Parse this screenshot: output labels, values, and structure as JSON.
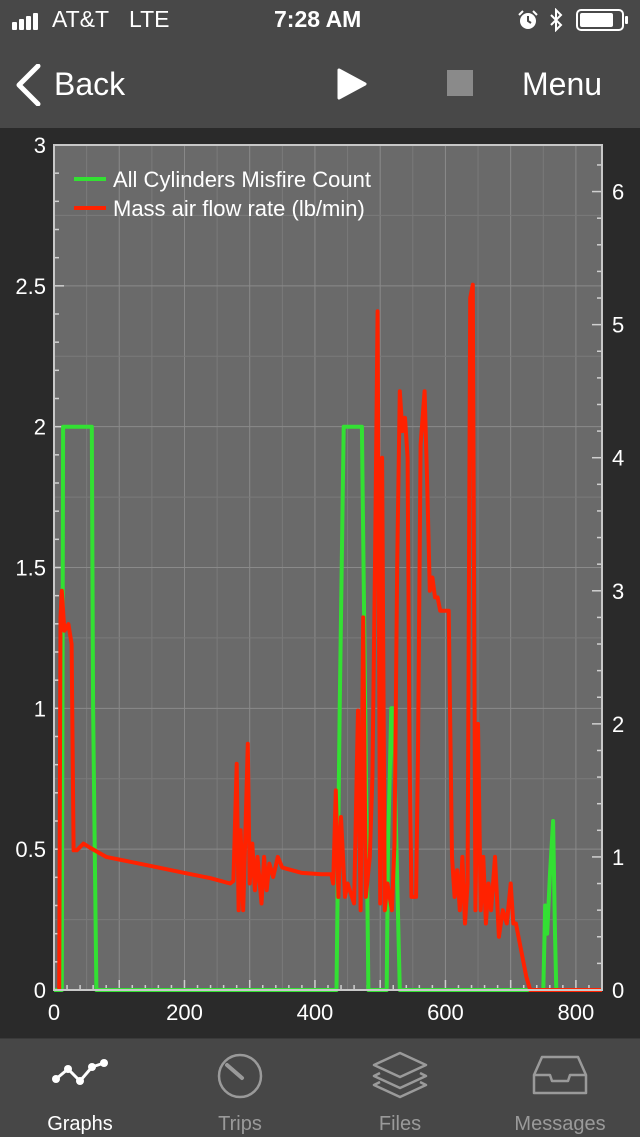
{
  "status": {
    "carrier": "AT&T",
    "network": "LTE",
    "time": "7:28 AM"
  },
  "nav": {
    "back_label": "Back",
    "menu_label": "Menu"
  },
  "tabs": [
    {
      "label": "Graphs",
      "icon": "graph-line-icon",
      "active": true
    },
    {
      "label": "Trips",
      "icon": "gauge-icon",
      "active": false
    },
    {
      "label": "Files",
      "icon": "layers-icon",
      "active": false
    },
    {
      "label": "Messages",
      "icon": "inbox-icon",
      "active": false
    }
  ],
  "colors": {
    "bar_bg": "#484848",
    "plot_bg": "#6a6a6a",
    "green": "#33e033",
    "red": "#ff2200",
    "inactive_tab": "#9a9a9a"
  },
  "chart_data": {
    "type": "line",
    "grid": true,
    "legend_position": "top-left",
    "xlim": [
      0,
      840
    ],
    "ylim_left": [
      0,
      3
    ],
    "ylim_right": [
      0,
      6.35
    ],
    "x_ticks": [
      "0",
      "200",
      "400",
      "600",
      "800"
    ],
    "y_ticks_left": [
      "0",
      "0.5",
      "1",
      "1.5",
      "2",
      "2.5",
      "3"
    ],
    "y_ticks_right": [
      "0",
      "1",
      "2",
      "3",
      "4",
      "5",
      "6"
    ],
    "series": [
      {
        "name": "All Cylinders Misfire Count",
        "axis": "left",
        "color": "#33e033",
        "points": [
          [
            0,
            0
          ],
          [
            12,
            0
          ],
          [
            14,
            2
          ],
          [
            58,
            2
          ],
          [
            60,
            1
          ],
          [
            65,
            0
          ],
          [
            433,
            0
          ],
          [
            438,
            1
          ],
          [
            444,
            2
          ],
          [
            472,
            2
          ],
          [
            477,
            1
          ],
          [
            482,
            0
          ],
          [
            510,
            0
          ],
          [
            512,
            0.5
          ],
          [
            517,
            1
          ],
          [
            520,
            1
          ],
          [
            527,
            0.3
          ],
          [
            530,
            0
          ],
          [
            750,
            0
          ],
          [
            753,
            0.3
          ],
          [
            756,
            0.2
          ],
          [
            760,
            0.4
          ],
          [
            765,
            0.6
          ],
          [
            768,
            0.2
          ],
          [
            770,
            0
          ],
          [
            840,
            0
          ]
        ]
      },
      {
        "name": "Mass air flow rate (lb/min)",
        "axis": "right",
        "color": "#ff2200",
        "points": [
          [
            8,
            0
          ],
          [
            10,
            2.8
          ],
          [
            12,
            3
          ],
          [
            16,
            2.7
          ],
          [
            22,
            2.75
          ],
          [
            27,
            2.6
          ],
          [
            30,
            1.05
          ],
          [
            35,
            1.05
          ],
          [
            45,
            1.1
          ],
          [
            55,
            1.07
          ],
          [
            80,
            1.0
          ],
          [
            150,
            0.93
          ],
          [
            200,
            0.88
          ],
          [
            240,
            0.84
          ],
          [
            270,
            0.8
          ],
          [
            275,
            0.82
          ],
          [
            280,
            1.7
          ],
          [
            283,
            0.6
          ],
          [
            286,
            1.2
          ],
          [
            290,
            0.6
          ],
          [
            293,
            1.1
          ],
          [
            297,
            1.85
          ],
          [
            300,
            0.8
          ],
          [
            304,
            1.1
          ],
          [
            308,
            0.75
          ],
          [
            312,
            1.0
          ],
          [
            318,
            0.65
          ],
          [
            322,
            1.0
          ],
          [
            326,
            0.75
          ],
          [
            330,
            0.95
          ],
          [
            336,
            0.85
          ],
          [
            343,
            1.0
          ],
          [
            350,
            0.92
          ],
          [
            380,
            0.88
          ],
          [
            410,
            0.87
          ],
          [
            425,
            0.87
          ],
          [
            428,
            0.8
          ],
          [
            432,
            1.5
          ],
          [
            436,
            0.7
          ],
          [
            440,
            1.3
          ],
          [
            446,
            0.7
          ],
          [
            450,
            0.8
          ],
          [
            460,
            0.65
          ],
          [
            466,
            2.1
          ],
          [
            470,
            0.6
          ],
          [
            474,
            2.8
          ],
          [
            478,
            0.7
          ],
          [
            484,
            1.0
          ],
          [
            488,
            1.6
          ],
          [
            492,
            3.2
          ],
          [
            496,
            5.1
          ],
          [
            500,
            0.65
          ],
          [
            503,
            4.0
          ],
          [
            507,
            0.6
          ],
          [
            511,
            0.8
          ],
          [
            518,
            0.6
          ],
          [
            522,
            1.1
          ],
          [
            526,
            3.2
          ],
          [
            530,
            4.5
          ],
          [
            534,
            4.2
          ],
          [
            538,
            4.3
          ],
          [
            542,
            4.0
          ],
          [
            545,
            1.8
          ],
          [
            548,
            0.7
          ],
          [
            555,
            0.7
          ],
          [
            558,
            1.8
          ],
          [
            562,
            4.1
          ],
          [
            568,
            4.5
          ],
          [
            572,
            3.8
          ],
          [
            576,
            3.0
          ],
          [
            580,
            3.1
          ],
          [
            584,
            2.95
          ],
          [
            588,
            2.95
          ],
          [
            592,
            2.85
          ],
          [
            605,
            2.85
          ],
          [
            610,
            1.0
          ],
          [
            614,
            0.7
          ],
          [
            618,
            0.9
          ],
          [
            622,
            0.6
          ],
          [
            626,
            1.0
          ],
          [
            630,
            0.5
          ],
          [
            634,
            0.8
          ],
          [
            638,
            5.2
          ],
          [
            642,
            5.3
          ],
          [
            646,
            0.6
          ],
          [
            650,
            2.0
          ],
          [
            654,
            0.6
          ],
          [
            658,
            1.0
          ],
          [
            662,
            0.5
          ],
          [
            666,
            0.8
          ],
          [
            670,
            0.6
          ],
          [
            676,
            1.0
          ],
          [
            682,
            0.4
          ],
          [
            688,
            0.6
          ],
          [
            694,
            0.5
          ],
          [
            700,
            0.8
          ],
          [
            704,
            0.5
          ],
          [
            708,
            0.5
          ],
          [
            712,
            0.4
          ],
          [
            716,
            0.3
          ],
          [
            720,
            0.2
          ],
          [
            724,
            0.1
          ],
          [
            730,
            0
          ],
          [
            840,
            0
          ]
        ]
      }
    ]
  }
}
